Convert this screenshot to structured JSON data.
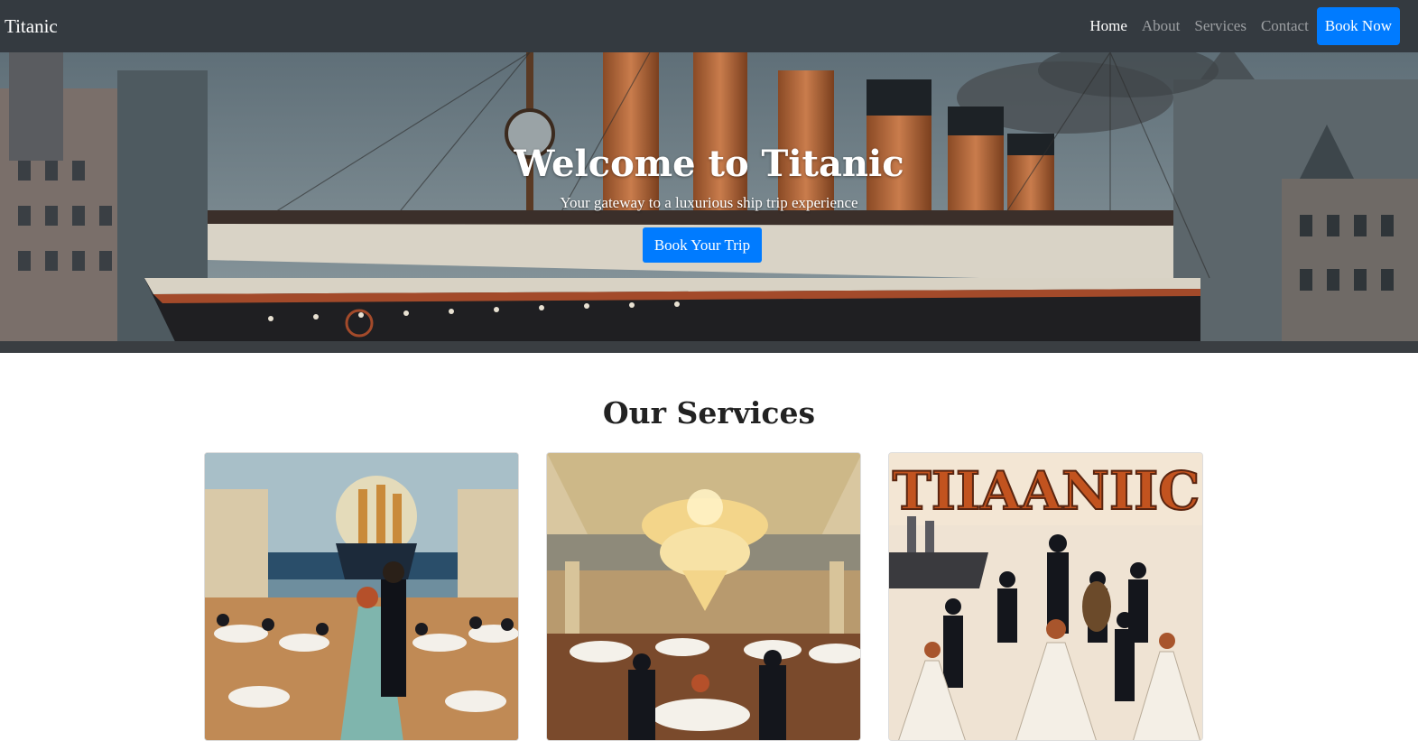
{
  "navbar": {
    "brand": "Titanic",
    "links": [
      {
        "label": "Home",
        "active": true
      },
      {
        "label": "About",
        "active": false
      },
      {
        "label": "Services",
        "active": false
      },
      {
        "label": "Contact",
        "active": false
      }
    ],
    "cta": "Book Now"
  },
  "hero": {
    "title": "Welcome to Titanic",
    "subtitle": "Your gateway to a luxurious ship trip experience",
    "button": "Book Your Trip"
  },
  "services": {
    "title": "Our Services",
    "cards": [
      {
        "image": "dining-dance-illustration"
      },
      {
        "image": "grand-ballroom-chandelier-illustration"
      },
      {
        "image": "titanic-entertainment-poster",
        "poster_text": "TIIAANIIC"
      }
    ]
  },
  "colors": {
    "navbar_bg": "#343a40",
    "primary": "#007bff",
    "text_dark": "#222222"
  }
}
